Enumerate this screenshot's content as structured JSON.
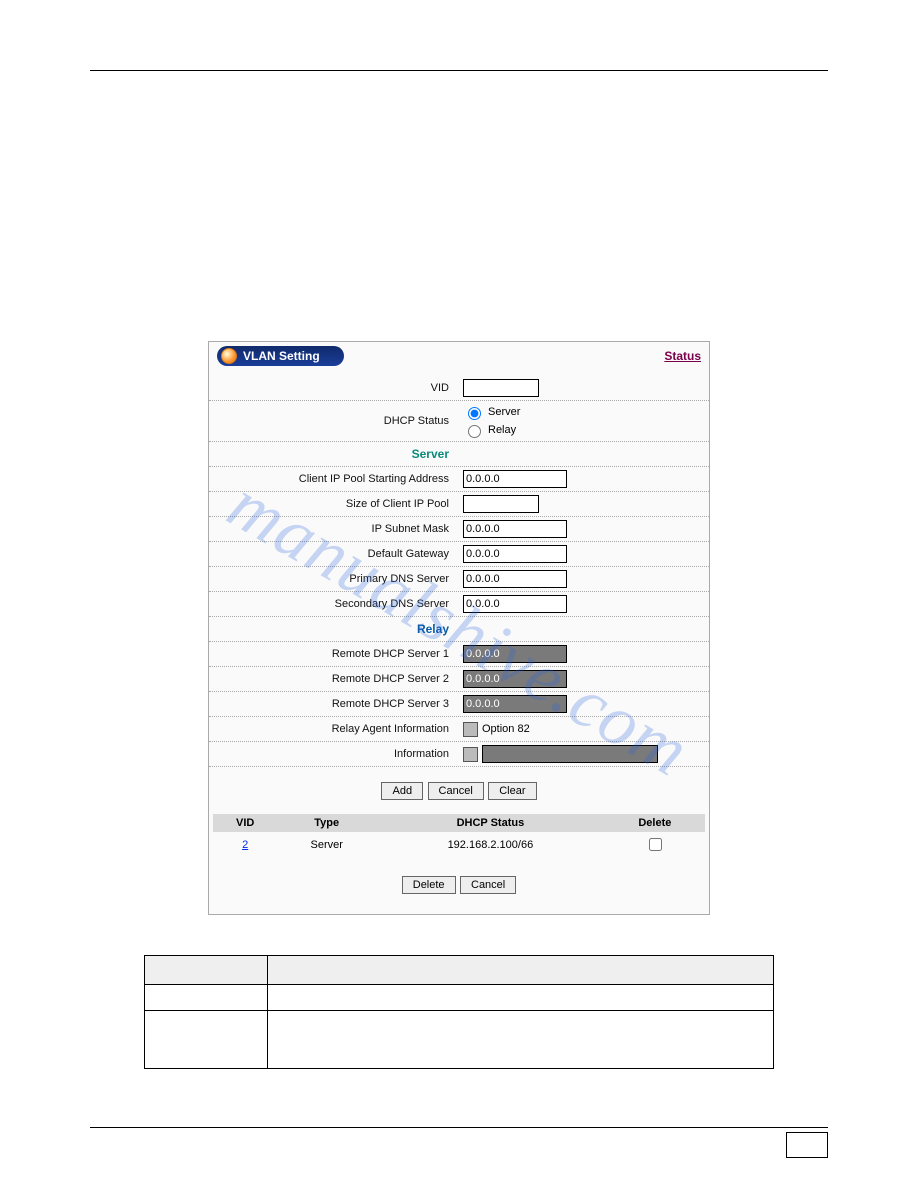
{
  "panel": {
    "title": "VLAN Setting",
    "status_link": "Status",
    "fields": {
      "vid_label": "VID",
      "vid_value": "",
      "dhcp_status_label": "DHCP Status",
      "dhcp_opt_server": "Server",
      "dhcp_opt_relay": "Relay",
      "server_section": "Server",
      "client_ip_label": "Client IP Pool Starting Address",
      "client_ip_value": "0.0.0.0",
      "pool_size_label": "Size of Client IP Pool",
      "pool_size_value": "",
      "subnet_label": "IP Subnet Mask",
      "subnet_value": "0.0.0.0",
      "gateway_label": "Default Gateway",
      "gateway_value": "0.0.0.0",
      "pdns_label": "Primary DNS Server",
      "pdns_value": "0.0.0.0",
      "sdns_label": "Secondary DNS Server",
      "sdns_value": "0.0.0.0",
      "relay_section": "Relay",
      "r1_label": "Remote DHCP Server 1",
      "r1_value": "0.0.0.0",
      "r2_label": "Remote DHCP Server 2",
      "r2_value": "0.0.0.0",
      "r3_label": "Remote DHCP Server 3",
      "r3_value": "0.0.0.0",
      "relay_agent_label": "Relay Agent Information",
      "option82": "Option 82",
      "info_label": "Information",
      "info_value": ""
    },
    "buttons": {
      "add": "Add",
      "cancel": "Cancel",
      "clear": "Clear",
      "delete": "Delete"
    },
    "table": {
      "h_vid": "VID",
      "h_type": "Type",
      "h_status": "DHCP Status",
      "h_delete": "Delete",
      "rows": [
        {
          "vid": "2",
          "type": "Server",
          "status": "192.168.2.100/66"
        }
      ]
    }
  },
  "watermark": "manualshive.com"
}
